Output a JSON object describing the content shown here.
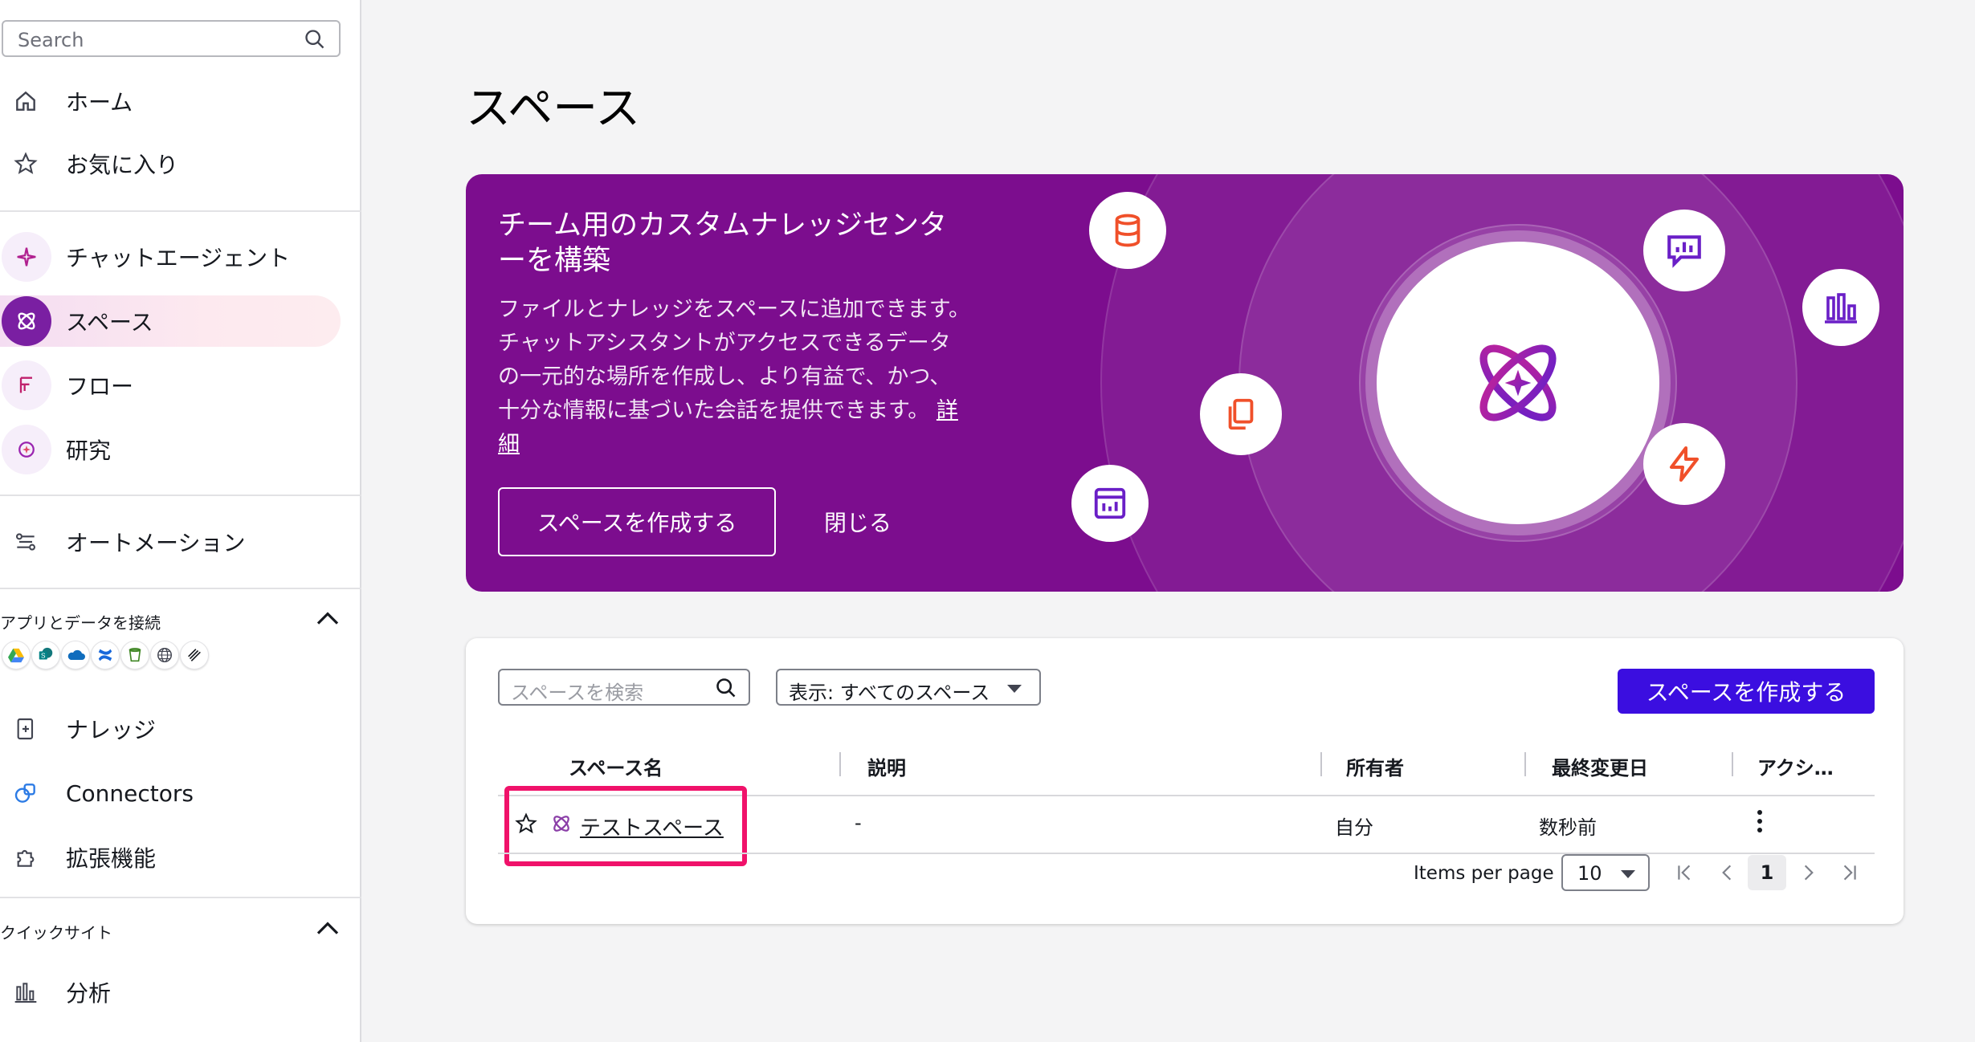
{
  "sidebar": {
    "search_placeholder": "Search",
    "items": {
      "home": "ホーム",
      "favorites": "お気に入り",
      "chat_agent": "チャットエージェント",
      "spaces": "スペース",
      "flows": "フロー",
      "research": "研究",
      "automation": "オートメーション",
      "knowledge": "ナレッジ",
      "connectors": "Connectors",
      "extensions": "拡張機能",
      "analysis": "分析"
    },
    "connect_section": "アプリとデータを接続",
    "quicksight_section": "クイックサイト",
    "app_icons": [
      "google-drive-icon",
      "sharepoint-icon",
      "onedrive-icon",
      "confluence-icon",
      "s3-bucket-icon",
      "web-globe-icon",
      "stacked-layers-icon"
    ]
  },
  "page": {
    "title": "スペース"
  },
  "banner": {
    "title": "チーム用のカスタムナレッジセンターを構築",
    "description": "ファイルとナレッジをスペースに追加できます。チャットアシスタントがアクセスできるデータの一元的な場所を作成し、より有益で、かつ、十分な情報に基づいた会話を提供できます。",
    "learn_more": "詳細",
    "create_button": "スペースを作成する",
    "close_button": "閉じる",
    "colors": {
      "background": "#7c0d8e",
      "accent_orange": "#f0502a",
      "accent_purple": "#6a1fc7"
    }
  },
  "panel": {
    "search_placeholder": "スペースを検索",
    "filter_value": "表示: すべてのスペース",
    "create_button": "スペースを作成する",
    "columns": {
      "name": "スペース名",
      "description": "説明",
      "owner": "所有者",
      "modified": "最終変更日",
      "actions": "アクシ…"
    },
    "rows": [
      {
        "name": "テストスペース",
        "description": "-",
        "owner": "自分",
        "modified": "数秒前"
      }
    ],
    "items_per_page_label": "Items per page",
    "items_per_page_value": "10",
    "current_page": "1",
    "colors": {
      "primary_button": "#3b0ee0",
      "highlight": "#f0126a"
    }
  }
}
